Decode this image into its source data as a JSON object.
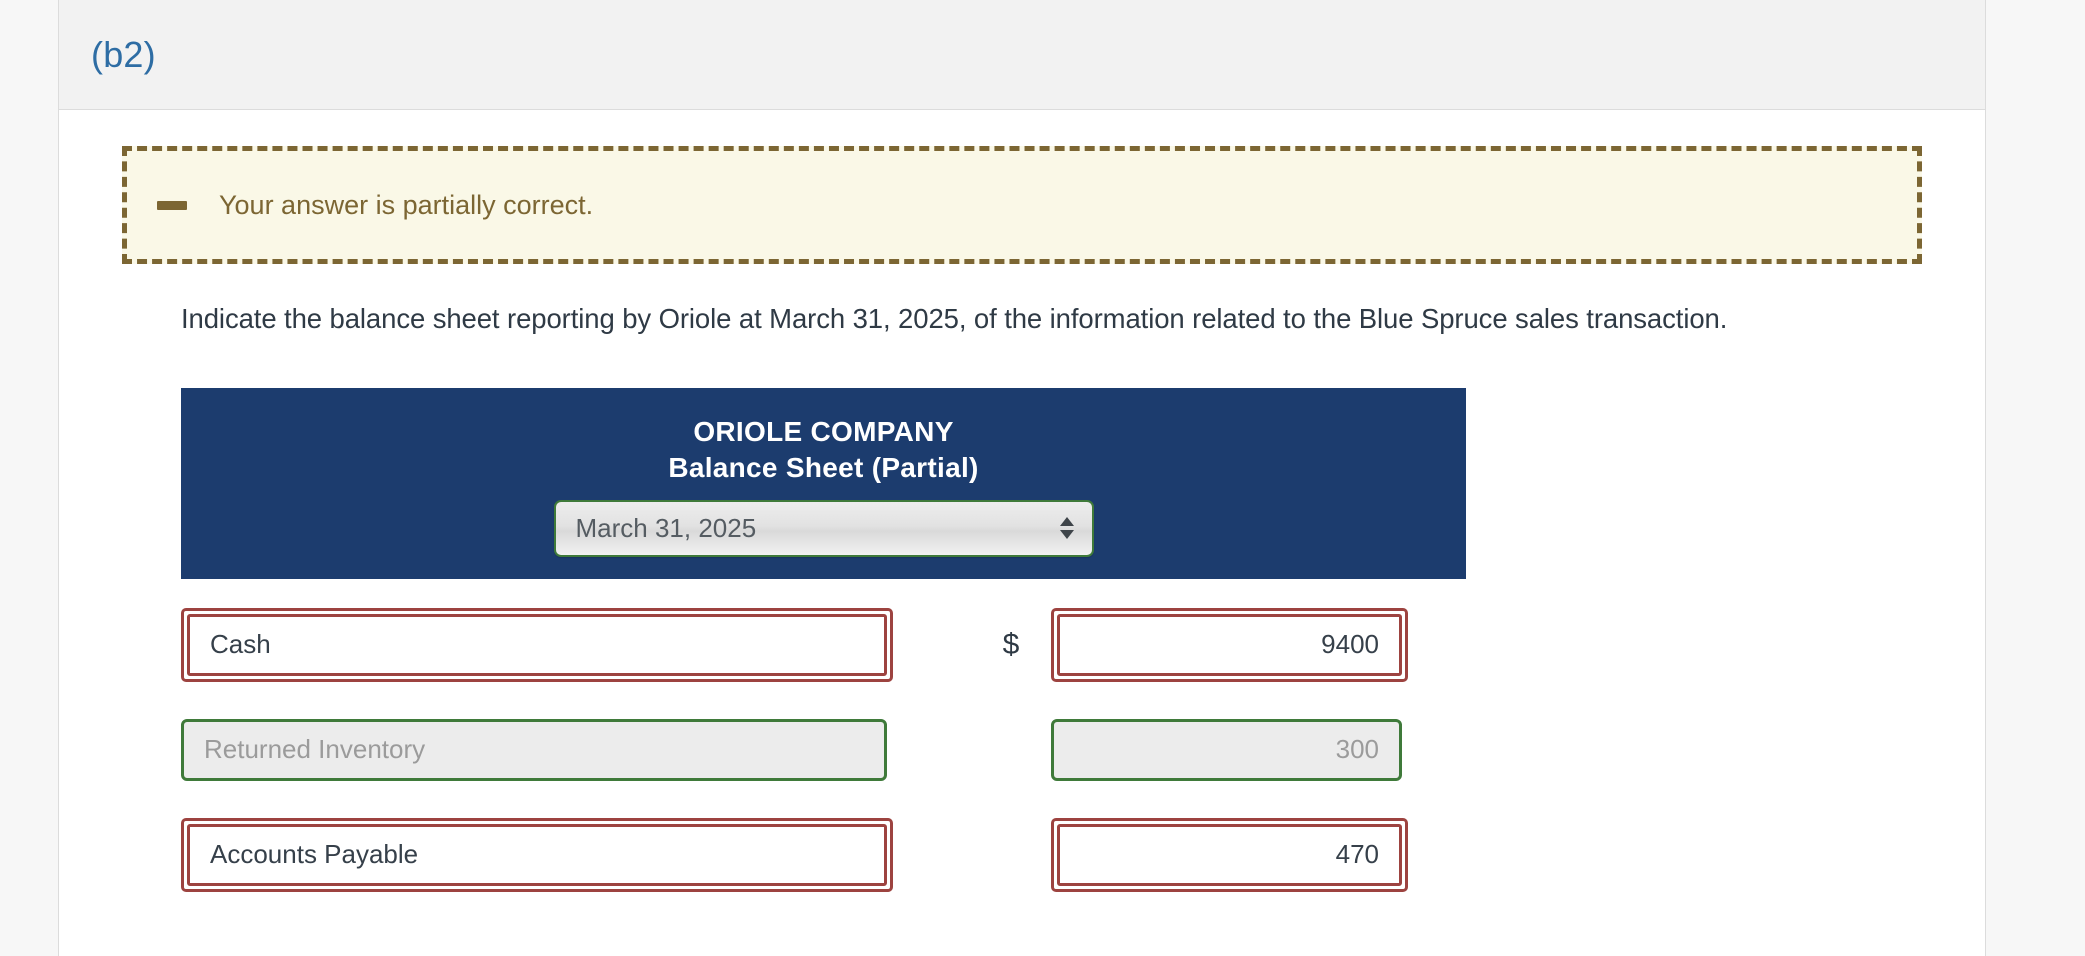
{
  "section": {
    "title": "(b2)"
  },
  "alert": {
    "icon": "minus-icon",
    "message": "Your answer is partially correct."
  },
  "instruction": "Indicate the balance sheet reporting by Oriole at March 31, 2025, of the information related to the Blue Spruce sales transaction.",
  "statement": {
    "company": "ORIOLE COMPANY",
    "subtitle": "Balance Sheet (Partial)",
    "date_select": {
      "value": "March 31, 2025",
      "options": [
        "March 31, 2025"
      ]
    },
    "currency_symbol": "$",
    "rows": [
      {
        "account": "Cash",
        "amount": "9400",
        "show_currency": true,
        "status": "incorrect"
      },
      {
        "account": "Returned Inventory",
        "amount": "300",
        "show_currency": false,
        "status": "correct"
      },
      {
        "account": "Accounts Payable",
        "amount": "470",
        "show_currency": false,
        "status": "incorrect"
      }
    ]
  },
  "colors": {
    "header_blue": "#1c3c6e",
    "section_title_blue": "#2e6da4",
    "alert_border": "#7c6633",
    "alert_bg": "#faf8e7",
    "incorrect_red": "#9d4340",
    "correct_green": "#3f7a3a"
  }
}
